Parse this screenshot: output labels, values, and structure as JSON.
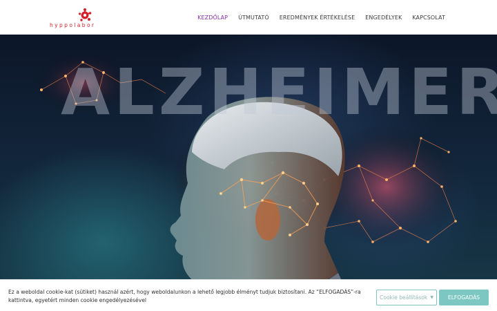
{
  "brand": {
    "logo_text": "hyppolabor",
    "accent": "#d3202a"
  },
  "nav": {
    "items": [
      {
        "label": "KEZDŐLAP",
        "active": true
      },
      {
        "label": "ÚTMUTATÓ",
        "active": false
      },
      {
        "label": "EREDMÉNYEK ÉRTÉKELÉSE",
        "active": false
      },
      {
        "label": "ENGEDÉLYEK",
        "active": false
      },
      {
        "label": "KAPCSOLAT",
        "active": false
      }
    ],
    "active_color": "#8a2da5"
  },
  "hero": {
    "title": "ALZHEIMER"
  },
  "cookie": {
    "text": "Ez a weboldal cookie-kat (sütiket) használ azért, hogy weboldalunkon a lehető legjobb élményt tudjuk biztosítani. Az “ELFOGADÁS”-ra kattintva, egyetért minden cookie engedélyezésével",
    "settings_label": "Cookie beállítások",
    "settings_icon": "caret-down-icon",
    "accept_label": "ELFOGADÁS",
    "accept_color": "#7cc7c2"
  }
}
